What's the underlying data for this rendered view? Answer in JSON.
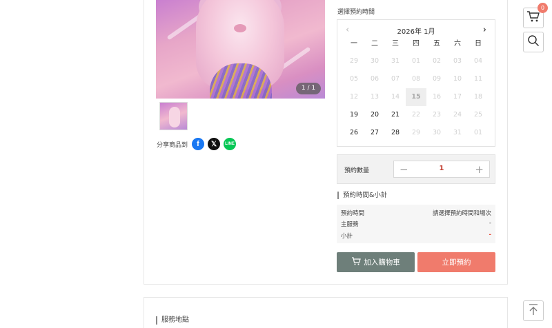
{
  "product": {
    "image_counter": "1 / 1",
    "share_label": "分享商品到",
    "share_icons": [
      "facebook-icon",
      "x-icon",
      "line-icon"
    ]
  },
  "calendar": {
    "section_label": "選擇預約時間",
    "month_label": "2026年 1月",
    "weekdays": [
      "一",
      "二",
      "三",
      "四",
      "五",
      "六",
      "日"
    ],
    "days": [
      "29",
      "30",
      "31",
      "01",
      "02",
      "03",
      "04",
      "05",
      "06",
      "07",
      "08",
      "09",
      "10",
      "11",
      "12",
      "13",
      "14",
      "15",
      "16",
      "17",
      "18",
      "19",
      "20",
      "21",
      "22",
      "23",
      "24",
      "25",
      "26",
      "27",
      "28",
      "29",
      "30",
      "31",
      "01"
    ],
    "available_days": [
      "19",
      "20",
      "21",
      "26",
      "27",
      "28"
    ],
    "today": "15"
  },
  "quantity": {
    "label": "預約數量",
    "value": "1",
    "minus": "−",
    "plus": "+"
  },
  "subtotal": {
    "title": "預約時間&小計",
    "rows": [
      {
        "label": "預約時間",
        "value": "請選擇預約時間和場次"
      },
      {
        "label": "主服務",
        "value": "-"
      },
      {
        "label": "小計",
        "value": "-"
      }
    ]
  },
  "actions": {
    "add_to_cart": "加入購物車",
    "book_now": "立即預約"
  },
  "service_location": {
    "title": "服務地點"
  },
  "floating": {
    "cart_count": "0"
  },
  "colors": {
    "cart_button": "#6e7f7a",
    "book_button": "#f07b6c",
    "badge": "#f07b6c",
    "quantity_value": "#c0392b"
  }
}
